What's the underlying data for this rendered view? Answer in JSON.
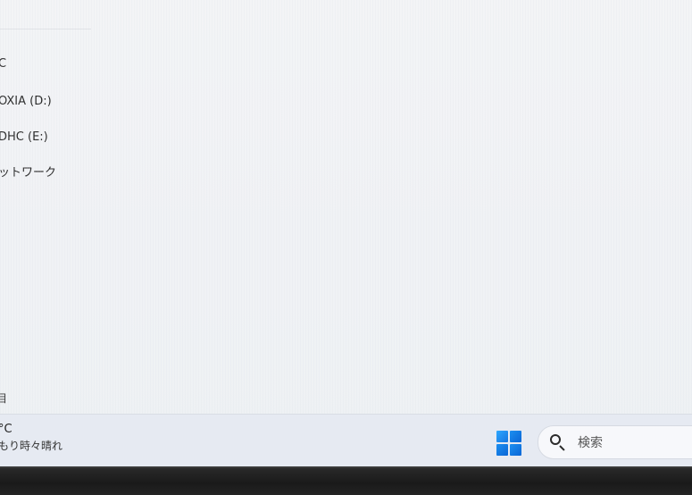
{
  "explorer": {
    "nav_items": [
      {
        "label": "C"
      },
      {
        "label": "OXIA (D:)"
      },
      {
        "label": "DHC (E:)"
      },
      {
        "label": "ットワーク"
      }
    ],
    "status_count": "目"
  },
  "taskbar": {
    "weather": {
      "temp": "°C",
      "desc": "もり時々晴れ"
    },
    "start_icon": "windows-logo-icon",
    "search": {
      "placeholder": "検索",
      "icon": "search-icon"
    }
  },
  "colors": {
    "accent": "#0a66d6",
    "taskbar_bg": "#e6eaf2",
    "window_bg": "#f3f4f6"
  }
}
